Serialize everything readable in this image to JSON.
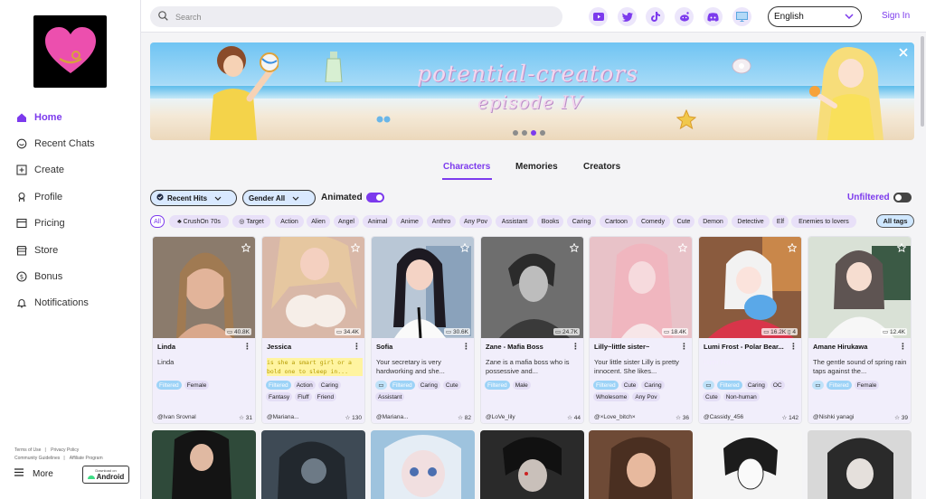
{
  "sidebar": {
    "items": [
      {
        "label": "Home",
        "icon": "home-icon"
      },
      {
        "label": "Recent Chats",
        "icon": "chat-icon"
      },
      {
        "label": "Create",
        "icon": "plus-icon"
      },
      {
        "label": "Profile",
        "icon": "user-icon"
      },
      {
        "label": "Pricing",
        "icon": "pricing-icon"
      },
      {
        "label": "Store",
        "icon": "store-icon"
      },
      {
        "label": "Bonus",
        "icon": "coin-icon"
      },
      {
        "label": "Notifications",
        "icon": "bell-icon"
      }
    ],
    "footer_links": [
      "Terms of Use",
      "Privacy Policy",
      "Community Guidelines",
      "Affiliate Program"
    ],
    "more_label": "More",
    "android_small": "Download on",
    "android_big": "Android"
  },
  "topbar": {
    "search_placeholder": "Search",
    "language": "English",
    "signin": "Sign In"
  },
  "banner": {
    "title_line1": "potential-creators",
    "title_line2": "episode IV"
  },
  "tabs": [
    "Characters",
    "Memories",
    "Creators"
  ],
  "filters": {
    "sort": "Recent Hits",
    "gender": "Gender All",
    "animated_label": "Animated",
    "unfiltered_label": "Unfiltered"
  },
  "tag_row": {
    "tags": [
      "All",
      "CrushOn 70s",
      "Target",
      "Action",
      "Alien",
      "Angel",
      "Animal",
      "Anime",
      "Anthro",
      "Any Pov",
      "Assistant",
      "Books",
      "Caring",
      "Cartoon",
      "Comedy",
      "Cute",
      "Demon",
      "Detective",
      "Elf",
      "Enemies to lovers"
    ],
    "all_tags": "All tags"
  },
  "cards": [
    {
      "name": "Linda",
      "desc": "Linda",
      "msgs": "40.8K",
      "tags": [
        "Filtered",
        "Female"
      ],
      "author": "@Ivan Srovnal",
      "rating": "31"
    },
    {
      "name": "Jessica",
      "desc": "is she a smart girl or a bold one to sleep in...",
      "msgs": "34.4K",
      "tags": [
        "Filtered",
        "Action",
        "Caring",
        "Fantasy",
        "Fluff",
        "Friend"
      ],
      "author": "@Mariana...",
      "rating": "130"
    },
    {
      "name": "Sofia",
      "desc": "Your secretary is very hardworking and she...",
      "msgs": "30.6K",
      "tags": [
        "Filtered",
        "Caring",
        "Cute",
        "Assistant"
      ],
      "author": "@Mariana...",
      "rating": "82"
    },
    {
      "name": "Zane - Mafia Boss",
      "desc": "Zane is a mafia boss who is possessive and...",
      "msgs": "24.7K",
      "tags": [
        "Filtered",
        "Male"
      ],
      "author": "@LoVe_lily",
      "rating": "44"
    },
    {
      "name": "Lilly~little sister~",
      "desc": "Your little sister Lilly is pretty innocent. She likes...",
      "msgs": "18.4K",
      "tags": [
        "Filtered",
        "Cute",
        "Caring",
        "Wholesome",
        "Any Pov"
      ],
      "author": "@×Love_bitch×",
      "rating": "36"
    },
    {
      "name": "Lumi Frost - Polar Bear...",
      "desc": "Lumi Fro...",
      "msgs": "16.2K",
      "msgs2": "4",
      "tags": [
        "Filtered",
        "Caring",
        "OC",
        "Cute",
        "Non-human"
      ],
      "author": "@Cassidy_456",
      "rating": "142"
    },
    {
      "name": "Amane Hirukawa",
      "desc": "The gentle sound of spring rain taps against the...",
      "msgs": "12.4K",
      "tags": [
        "Filtered",
        "Female"
      ],
      "author": "@Nishki yanagi",
      "rating": "39"
    }
  ],
  "colors": {
    "accent": "#7c3aed",
    "filtered_tag": "#9dd3f7",
    "card_info": "#f1eefb"
  }
}
